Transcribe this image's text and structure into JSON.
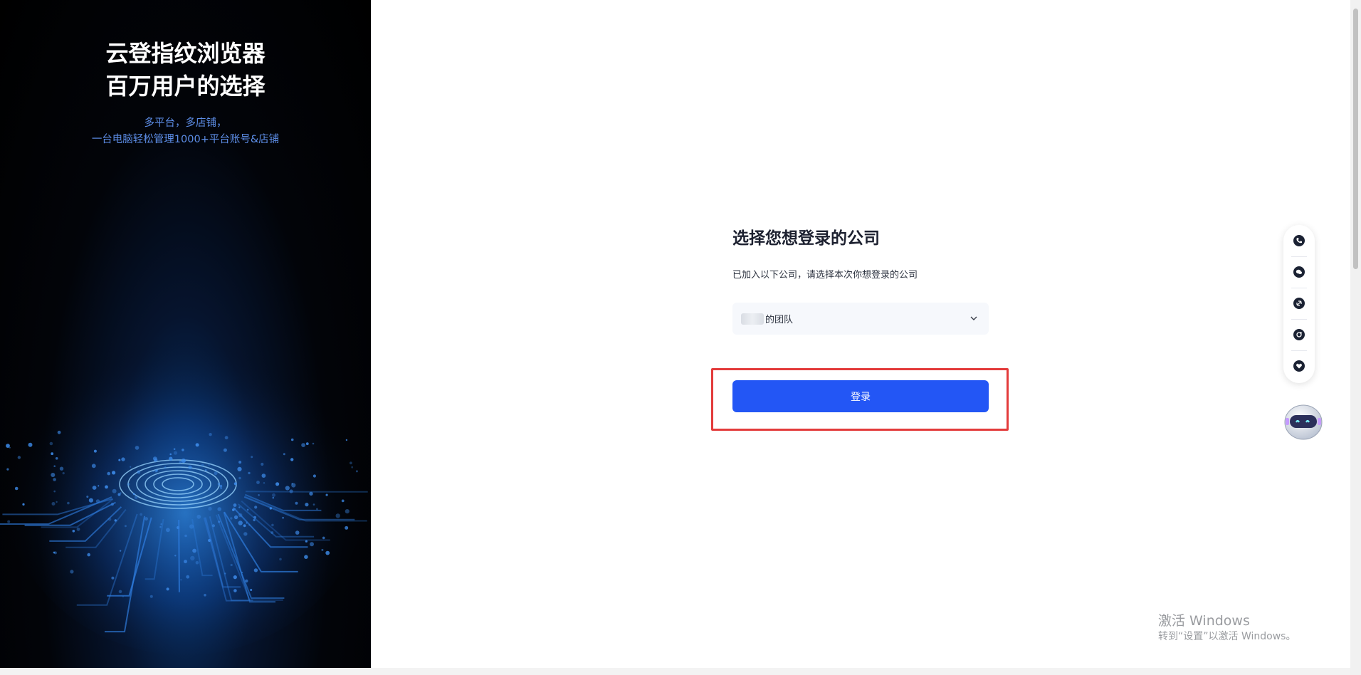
{
  "promo": {
    "title_line1": "云登指纹浏览器",
    "title_line2": "百万用户的选择",
    "sub_line1": "多平台，多店铺，",
    "sub_line2": "一台电脑轻松管理1000+平台账号&店铺"
  },
  "login": {
    "title": "选择您想登录的公司",
    "description": "已加入以下公司，请选择本次你想登录的公司",
    "company_select_value": "的团队",
    "login_button": "登录"
  },
  "float_toolbar": {
    "icons": [
      "phone-icon",
      "wechat-icon",
      "link-icon",
      "sync-icon",
      "heart-icon"
    ]
  },
  "watermark": {
    "line1": "激活 Windows",
    "line2": "转到“设置”以激活 Windows。"
  },
  "colors": {
    "primary": "#2356f5",
    "highlight_border": "#e33b3b",
    "promo_sub": "#5d8ee8"
  }
}
